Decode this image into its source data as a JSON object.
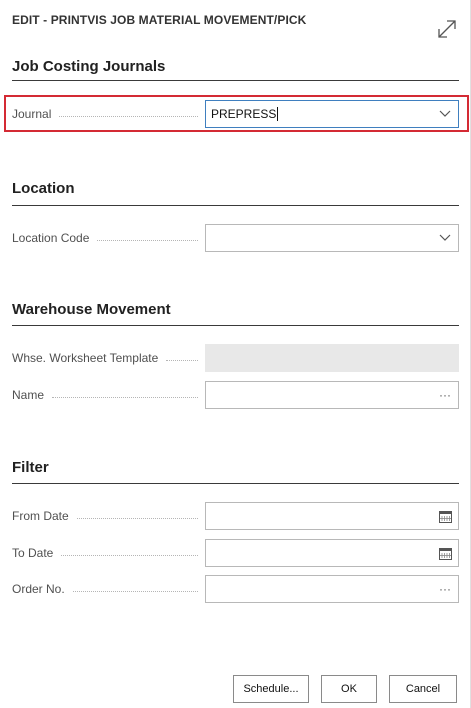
{
  "dialog": {
    "title": "EDIT - PRINTVIS JOB MATERIAL MOVEMENT/PICK"
  },
  "sections": {
    "job_costing": {
      "title": "Job Costing Journals",
      "journal": {
        "label": "Journal",
        "value": "PREPRESS"
      }
    },
    "location": {
      "title": "Location",
      "location_code": {
        "label": "Location Code",
        "value": ""
      }
    },
    "warehouse": {
      "title": "Warehouse Movement",
      "worksheet_template": {
        "label": "Whse. Worksheet Template",
        "value": ""
      },
      "name": {
        "label": "Name",
        "value": "",
        "button": "···"
      }
    },
    "filter": {
      "title": "Filter",
      "from_date": {
        "label": "From Date",
        "value": ""
      },
      "to_date": {
        "label": "To Date",
        "value": ""
      },
      "order_no": {
        "label": "Order No.",
        "value": "",
        "button": "···"
      }
    }
  },
  "buttons": {
    "schedule": "Schedule...",
    "ok": "OK",
    "cancel": "Cancel"
  },
  "icons": {
    "expand": "expand-diagonal-icon",
    "dropdown": "chevron-down-icon",
    "calendar": "calendar-icon",
    "lookup": "ellipsis-icon"
  },
  "colors": {
    "highlight": "#d42a34",
    "focus_border": "#3f7fbf",
    "disabled_bg": "#e8e8e8"
  }
}
